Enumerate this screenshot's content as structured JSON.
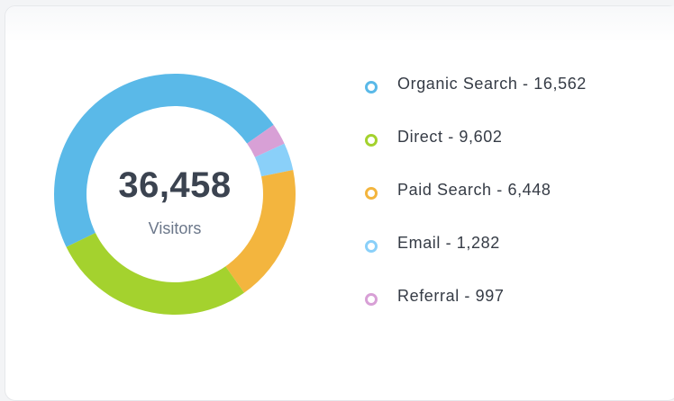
{
  "chart_data": {
    "type": "pie",
    "style": "donut",
    "total": "36,458",
    "center_label": "Visitors",
    "legend_placement": "right",
    "slices": [
      {
        "name": "Organic Search",
        "value": 16562,
        "display": "16,562",
        "color": "#5ab9e8"
      },
      {
        "name": "Direct",
        "value": 9602,
        "display": "9,602",
        "color": "#a4d22e"
      },
      {
        "name": "Paid Search",
        "value": 6448,
        "display": "6,448",
        "color": "#f3b53e"
      },
      {
        "name": "Email",
        "value": 1282,
        "display": "1,282",
        "color": "#8ad0f9"
      },
      {
        "name": "Referral",
        "value": 997,
        "display": "997",
        "color": "#d8a0d6"
      }
    ]
  }
}
